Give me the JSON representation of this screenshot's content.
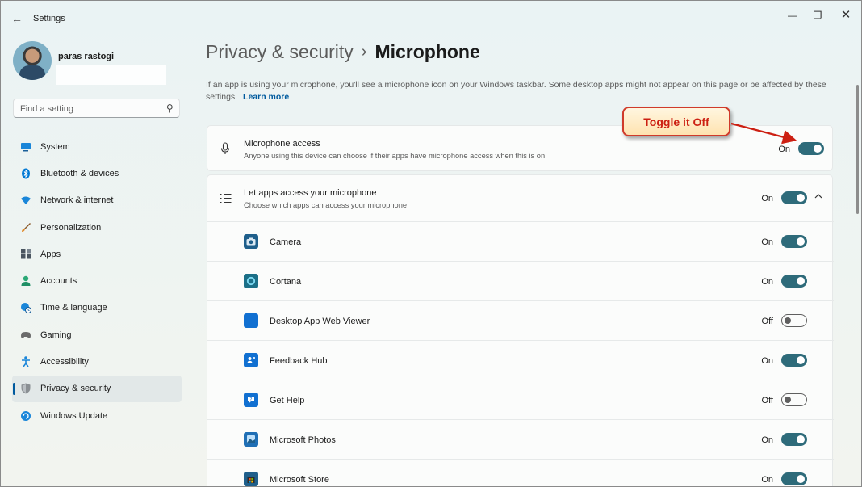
{
  "window": {
    "title": "Settings",
    "back_glyph": "←",
    "minimize_glyph": "—",
    "maximize_glyph": "❐",
    "close_glyph": "✕"
  },
  "user": {
    "name": "paras rastogi"
  },
  "search": {
    "placeholder": "Find a setting",
    "icon": "search-icon"
  },
  "sidebar": {
    "items": [
      {
        "label": "System",
        "icon": "system-icon",
        "color": "#0078d4"
      },
      {
        "label": "Bluetooth & devices",
        "icon": "bluetooth-icon",
        "color": "#0078d4"
      },
      {
        "label": "Network & internet",
        "icon": "wifi-icon",
        "color": "#1a86d9"
      },
      {
        "label": "Personalization",
        "icon": "brush-icon",
        "color": "#d9822b"
      },
      {
        "label": "Apps",
        "icon": "apps-icon",
        "color": "#4a5560"
      },
      {
        "label": "Accounts",
        "icon": "account-icon",
        "color": "#2aa876"
      },
      {
        "label": "Time & language",
        "icon": "globe-clock-icon",
        "color": "#1a86d9"
      },
      {
        "label": "Gaming",
        "icon": "controller-icon",
        "color": "#6b6b6b"
      },
      {
        "label": "Accessibility",
        "icon": "accessibility-icon",
        "color": "#1a86d9"
      },
      {
        "label": "Privacy & security",
        "icon": "shield-icon",
        "color": "#6b6b6b",
        "active": true
      },
      {
        "label": "Windows Update",
        "icon": "update-icon",
        "color": "#1a86d9"
      }
    ]
  },
  "header": {
    "parent": "Privacy & security",
    "separator": "›",
    "current": "Microphone"
  },
  "description": {
    "text": "If an app is using your microphone, you'll see a microphone icon on your Windows taskbar. Some desktop apps might not appear on this page or be affected by these settings.",
    "link": "Learn more"
  },
  "microphone_access": {
    "title": "Microphone access",
    "subtitle": "Anyone using this device can choose if their apps have microphone access when this is on",
    "state": "On",
    "on": true
  },
  "apps_access": {
    "title": "Let apps access your microphone",
    "subtitle": "Choose which apps can access your microphone",
    "state": "On",
    "on": true,
    "apps": [
      {
        "name": "Camera",
        "state": "On",
        "on": true,
        "icon": "camera-app-icon",
        "color": "#1f5f8b"
      },
      {
        "name": "Cortana",
        "state": "On",
        "on": true,
        "icon": "cortana-app-icon",
        "color": "#1b6f87"
      },
      {
        "name": "Desktop App Web Viewer",
        "state": "Off",
        "on": false,
        "icon": "web-viewer-app-icon",
        "color": "#1170d1"
      },
      {
        "name": "Feedback Hub",
        "state": "On",
        "on": true,
        "icon": "feedback-hub-app-icon",
        "color": "#1170d1"
      },
      {
        "name": "Get Help",
        "state": "Off",
        "on": false,
        "icon": "get-help-app-icon",
        "color": "#1170d1"
      },
      {
        "name": "Microsoft Photos",
        "state": "On",
        "on": true,
        "icon": "photos-app-icon",
        "color": "#1f6fb5"
      },
      {
        "name": "Microsoft Store",
        "state": "On",
        "on": true,
        "icon": "store-app-icon",
        "color": "#1f5f8b"
      }
    ]
  },
  "annotation": {
    "callout_text": "Toggle it Off",
    "color": "#cc1f12"
  }
}
